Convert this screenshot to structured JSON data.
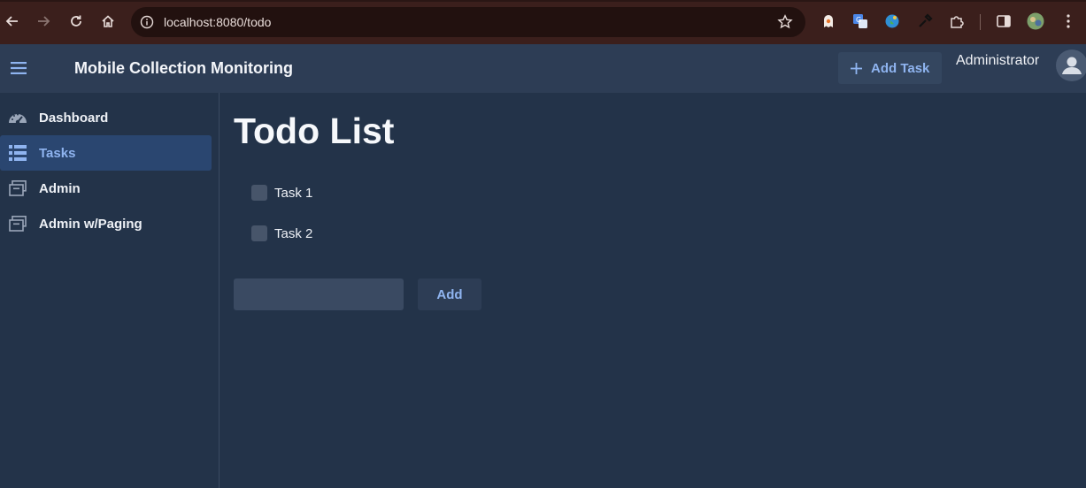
{
  "browser": {
    "url": "localhost:8080/todo",
    "icons": [
      "back-icon",
      "forward-icon",
      "reload-icon",
      "home-icon",
      "info-icon",
      "star-icon",
      "extension-icon",
      "menu-icon"
    ]
  },
  "header": {
    "title": "Mobile Collection Monitoring",
    "add_task_label": "Add Task",
    "username": "Administrator"
  },
  "sidebar": {
    "items": [
      {
        "label": "Dashboard",
        "icon": "gauge-icon",
        "active": false
      },
      {
        "label": "Tasks",
        "icon": "list-icon",
        "active": true
      },
      {
        "label": "Admin",
        "icon": "archive-icon",
        "active": false
      },
      {
        "label": "Admin w/Paging",
        "icon": "archive-icon",
        "active": false
      }
    ]
  },
  "main": {
    "title": "Todo List",
    "tasks": [
      {
        "label": "Task 1",
        "checked": false
      },
      {
        "label": "Task 2",
        "checked": false
      }
    ],
    "new_task_value": "",
    "add_button_label": "Add"
  },
  "colors": {
    "background": "#233349",
    "header": "#2d3d55",
    "accent": "#8fb4f0",
    "active_nav": "#2a4670"
  }
}
